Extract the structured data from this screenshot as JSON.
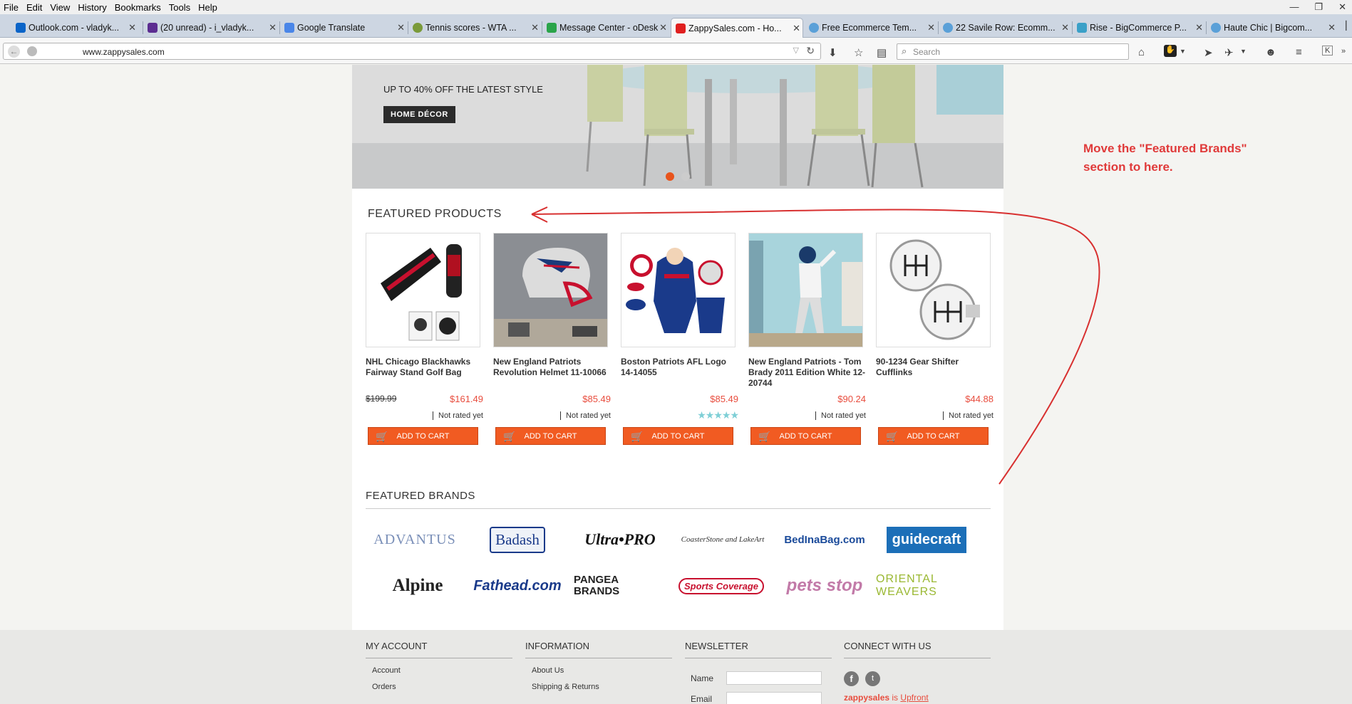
{
  "menu": [
    "File",
    "Edit",
    "View",
    "History",
    "Bookmarks",
    "Tools",
    "Help"
  ],
  "tabs": [
    {
      "title": "Outlook.com - vladyk...",
      "color": "#0a64c8"
    },
    {
      "title": "(20 unread) - i_vladyk...",
      "color": "#5c2d91"
    },
    {
      "title": "Google Translate",
      "color": "#4a86e8"
    },
    {
      "title": "Tennis scores - WTA ...",
      "color": "#7a9a3a"
    },
    {
      "title": "Message Center - oDesk",
      "color": "#2aa44a"
    },
    {
      "title": "ZappySales.com - Ho...",
      "color": "#e02020"
    },
    {
      "title": "Free Ecommerce Tem...",
      "color": "#5aa0d8"
    },
    {
      "title": "22 Savile Row: Ecomm...",
      "color": "#5aa0d8"
    },
    {
      "title": "Rise - BigCommerce P...",
      "color": "#3aa0c8"
    },
    {
      "title": "Haute Chic | Bigcom...",
      "color": "#5aa0d8"
    }
  ],
  "url": "www.zappysales.com",
  "search_placeholder": "Search",
  "hero": {
    "title": "UP TO 40% OFF THE LATEST STYLE",
    "button": "HOME DÉCOR",
    "active_dot_color": "#e8541c"
  },
  "featured_products": {
    "title": "FEATURED PRODUCTS",
    "items": [
      {
        "name": "NHL Chicago Blackhawks Fairway Stand Golf Bag",
        "old_price": "$199.99",
        "price": "$161.49",
        "rating": "Not rated yet",
        "cart": "ADD TO CART"
      },
      {
        "name": "New England Patriots Revolution Helmet 11-10066",
        "old_price": "",
        "price": "$85.49",
        "rating": "Not rated yet",
        "cart": "ADD TO CART"
      },
      {
        "name": "Boston Patriots AFL Logo 14-14055",
        "old_price": "",
        "price": "$85.49",
        "rating": "",
        "stars": 5,
        "cart": "ADD TO CART"
      },
      {
        "name": "New England Patriots - Tom Brady 2011 Edition White 12-20744",
        "old_price": "",
        "price": "$90.24",
        "rating": "Not rated yet",
        "cart": "ADD TO CART"
      },
      {
        "name": "90-1234 Gear Shifter Cufflinks",
        "old_price": "",
        "price": "$44.88",
        "rating": "Not rated yet",
        "cart": "ADD TO CART"
      }
    ]
  },
  "featured_brands": {
    "title": "FEATURED BRANDS",
    "brands": [
      "ADVANTUS",
      "Badash",
      "Ultra•PRO",
      "CoasterStone and LakeArt",
      "BedInaBag.com",
      "guidecraft",
      "Alpine",
      "Fathead.com",
      "PANGEA BRANDS",
      "Sports Coverage",
      "pets stop",
      "ORIENTAL WEAVERS"
    ]
  },
  "annotation": {
    "line1": "Move the \"Featured Brands\"",
    "line2": "section to here.",
    "color": "#e03a3a"
  },
  "footer": {
    "my_account": {
      "title": "MY ACCOUNT",
      "links": [
        "Account",
        "Orders"
      ]
    },
    "information": {
      "title": "INFORMATION",
      "links": [
        "About Us",
        "Shipping & Returns"
      ]
    },
    "newsletter": {
      "title": "NEWSLETTER",
      "name_label": "Name",
      "email_label": "Email"
    },
    "connect": {
      "title": "CONNECT WITH US",
      "brand": "zappysales",
      "is": "is",
      "upfront": "Upfront"
    }
  }
}
